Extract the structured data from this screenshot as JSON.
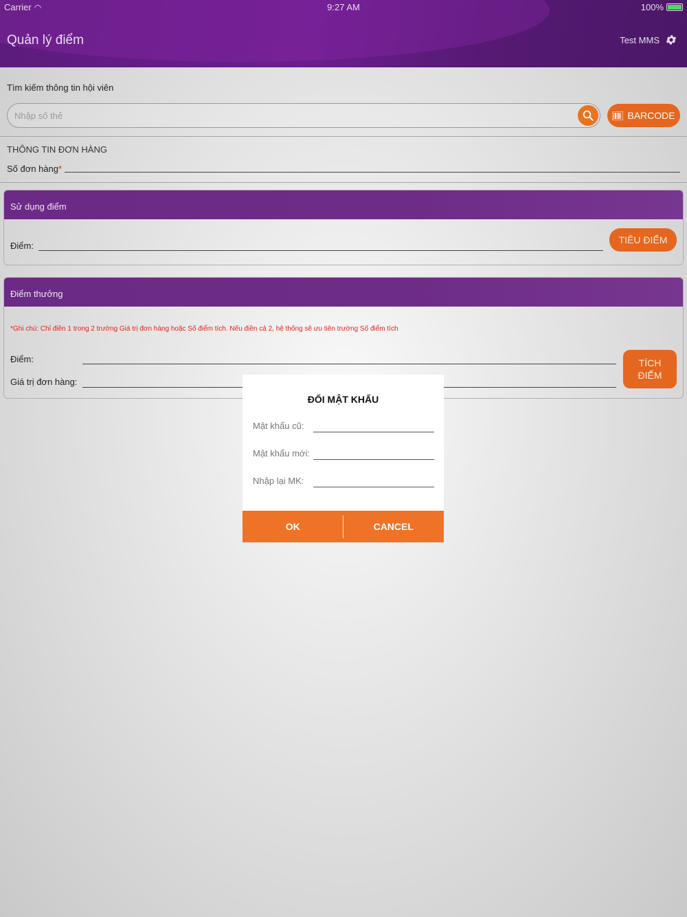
{
  "status_bar": {
    "carrier": "Carrier",
    "time": "9:27 AM",
    "battery": "100%"
  },
  "header": {
    "title": "Quản lý điểm",
    "user": "Test MMS"
  },
  "search": {
    "label": "Tìm kiếm thông tin hội viên",
    "placeholder": "Nhập số thẻ",
    "barcode_label": "BARCODE"
  },
  "order": {
    "title": "THÔNG TIN ĐƠN HÀNG",
    "number_label": "Số đơn hàng",
    "required_mark": "*"
  },
  "use_points": {
    "title": "Sử dụng điểm",
    "points_label": "Điểm:",
    "button": "TIÊU ĐIỂM"
  },
  "reward_points": {
    "title": "Điểm thưởng",
    "note": "*Ghi chú:  Chỉ điền 1 trong 2 trường Giá trị đơn hàng hoặc Số điểm tích. Nếu điền cả 2, hệ thống sẽ ưu tiên trường Số điểm tích",
    "points_label": "Điểm:",
    "order_value_label": "Giá trị đơn hàng:",
    "button_line1": "TÍCH",
    "button_line2": "ĐIỂM"
  },
  "modal": {
    "title": "ĐỔI MẬT KHẨU",
    "old_password_label": "Mật khẩu cũ:",
    "new_password_label": "Mật khẩu mới:",
    "confirm_label": "Nhập lại MK:",
    "ok": "OK",
    "cancel": "CANCEL"
  },
  "colors": {
    "purple": "#6a2a85",
    "orange": "#e5661e",
    "required": "#e8201a"
  }
}
